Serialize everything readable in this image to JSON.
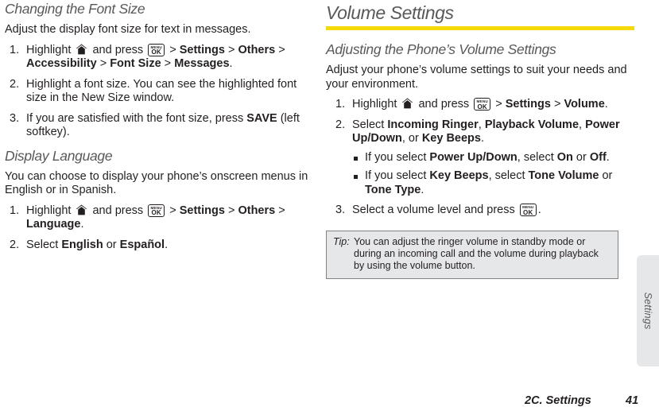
{
  "left_column": {
    "section1": {
      "title": "Changing the Font Size",
      "intro": "Adjust the display font size for text in messages.",
      "steps": [
        {
          "num": "1.",
          "parts": [
            {
              "t": "Highlight ",
              "b": false
            },
            {
              "t": "home-icon",
              "icon": "home"
            },
            {
              "t": " and press ",
              "b": false
            },
            {
              "t": "menu-ok-icon",
              "icon": "menuok"
            },
            {
              "t": " > ",
              "b": false
            },
            {
              "t": "Settings",
              "b": true
            },
            {
              "t": " > ",
              "b": false
            },
            {
              "t": "Others",
              "b": true
            },
            {
              "t": " > ",
              "b": false
            },
            {
              "t": "Accessibility",
              "b": true
            },
            {
              "t": " > ",
              "b": false
            },
            {
              "t": "Font Size",
              "b": true
            },
            {
              "t": " > ",
              "b": false
            },
            {
              "t": "Messages",
              "b": true
            },
            {
              "t": ".",
              "b": false
            }
          ]
        },
        {
          "num": "2.",
          "parts": [
            {
              "t": "Highlight a font size. You can see the highlighted font size in the New Size window.",
              "b": false
            }
          ]
        },
        {
          "num": "3.",
          "parts": [
            {
              "t": "If you are satisfied with the font size, press ",
              "b": false
            },
            {
              "t": "SAVE",
              "b": true
            },
            {
              "t": " (left softkey).",
              "b": false
            }
          ]
        }
      ]
    },
    "section2": {
      "title": "Display Language",
      "intro": "You can choose to display your phone’s onscreen menus in English or in Spanish.",
      "steps": [
        {
          "num": "1.",
          "parts": [
            {
              "t": "Highlight ",
              "b": false
            },
            {
              "t": "home-icon",
              "icon": "home"
            },
            {
              "t": " and press ",
              "b": false
            },
            {
              "t": "menu-ok-icon",
              "icon": "menuok"
            },
            {
              "t": " > ",
              "b": false
            },
            {
              "t": "Settings",
              "b": true
            },
            {
              "t": " > ",
              "b": false
            },
            {
              "t": "Others",
              "b": true
            },
            {
              "t": " > ",
              "b": false
            },
            {
              "t": "Language",
              "b": true
            },
            {
              "t": ".",
              "b": false
            }
          ]
        },
        {
          "num": "2.",
          "parts": [
            {
              "t": "Select ",
              "b": false
            },
            {
              "t": "English",
              "b": true
            },
            {
              "t": " or ",
              "b": false
            },
            {
              "t": "Español",
              "b": true
            },
            {
              "t": ".",
              "b": false
            }
          ]
        }
      ]
    }
  },
  "right_column": {
    "chapter_title": "Volume Settings",
    "rule_color": "#f6d908",
    "section": {
      "title": "Adjusting the Phone’s Volume Settings",
      "intro": "Adjust your phone’s volume settings to suit your needs and your environment.",
      "steps": [
        {
          "num": "1.",
          "parts": [
            {
              "t": "Highlight ",
              "b": false
            },
            {
              "t": "home-icon",
              "icon": "home"
            },
            {
              "t": " and press ",
              "b": false
            },
            {
              "t": "menu-ok-icon",
              "icon": "menuok"
            },
            {
              "t": " > ",
              "b": false
            },
            {
              "t": "Settings",
              "b": true
            },
            {
              "t": " > ",
              "b": false
            },
            {
              "t": "Volume",
              "b": true
            },
            {
              "t": ".",
              "b": false
            }
          ]
        },
        {
          "num": "2.",
          "parts": [
            {
              "t": "Select ",
              "b": false
            },
            {
              "t": "Incoming Ringer",
              "b": true
            },
            {
              "t": ", ",
              "b": false
            },
            {
              "t": "Playback Volume",
              "b": true
            },
            {
              "t": ", ",
              "b": false
            },
            {
              "t": "Power Up/Down",
              "b": true
            },
            {
              "t": ", or ",
              "b": false
            },
            {
              "t": "Key Beeps",
              "b": true
            },
            {
              "t": ".",
              "b": false
            }
          ],
          "subs": [
            [
              {
                "t": "If you select ",
                "b": false
              },
              {
                "t": "Power Up/Down",
                "b": true
              },
              {
                "t": ", select ",
                "b": false
              },
              {
                "t": "On",
                "b": true
              },
              {
                "t": " or ",
                "b": false
              },
              {
                "t": "Off",
                "b": true
              },
              {
                "t": ".",
                "b": false
              }
            ],
            [
              {
                "t": "If you select ",
                "b": false
              },
              {
                "t": "Key Beeps",
                "b": true
              },
              {
                "t": ", select ",
                "b": false
              },
              {
                "t": "Tone Volume",
                "b": true
              },
              {
                "t": " or ",
                "b": false
              },
              {
                "t": "Tone Type",
                "b": true
              },
              {
                "t": ".",
                "b": false
              }
            ]
          ]
        },
        {
          "num": "3.",
          "parts": [
            {
              "t": "Select a volume level and press ",
              "b": false
            },
            {
              "t": "menu-ok-icon",
              "icon": "menuok"
            },
            {
              "t": ".",
              "b": false
            }
          ]
        }
      ]
    },
    "tip": {
      "label": "Tip:",
      "text": "You can adjust the ringer volume in standby mode or during an incoming call and the volume during playback by using the volume button."
    }
  },
  "side_tab": {
    "label": "Settings"
  },
  "footer": {
    "chapter": "2C. Settings",
    "page": "41"
  },
  "icons": {
    "home": "home-icon",
    "menuok_top": "MENU",
    "menuok_bottom": "OK"
  }
}
